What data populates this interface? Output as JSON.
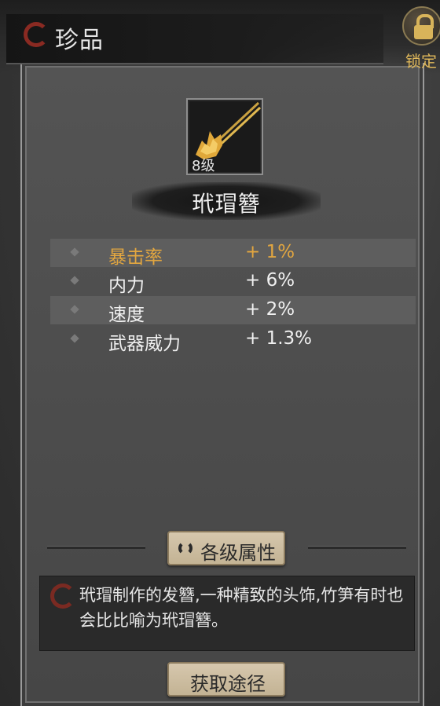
{
  "header": {
    "title": "珍品"
  },
  "lock": {
    "label": "锁定"
  },
  "item": {
    "level": "8级",
    "name": "玳瑁簪"
  },
  "stats": [
    {
      "name": "暴击率",
      "value": "+ 1%",
      "highlight": true
    },
    {
      "name": "内力",
      "value": "+ 6%",
      "highlight": false
    },
    {
      "name": "速度",
      "value": "+ 2%",
      "highlight": false
    },
    {
      "name": "武器威力",
      "value": "+ 1.3%",
      "highlight": false
    }
  ],
  "levels_button": {
    "label": "各级属性"
  },
  "description": {
    "text": "玳瑁制作的发簪,一种精致的头饰,竹笋有时也会比比喻为玳瑁簪。"
  },
  "obtain_button": {
    "label": "获取途径"
  },
  "colors": {
    "highlight": "#e2a640",
    "accent_red": "#8a2a22",
    "gold": "#d8b45a"
  },
  "icons": [
    "swirl-emblem-icon",
    "lock-icon",
    "hairpin-item-icon",
    "diamond-bullet-icon",
    "refresh-icon"
  ]
}
